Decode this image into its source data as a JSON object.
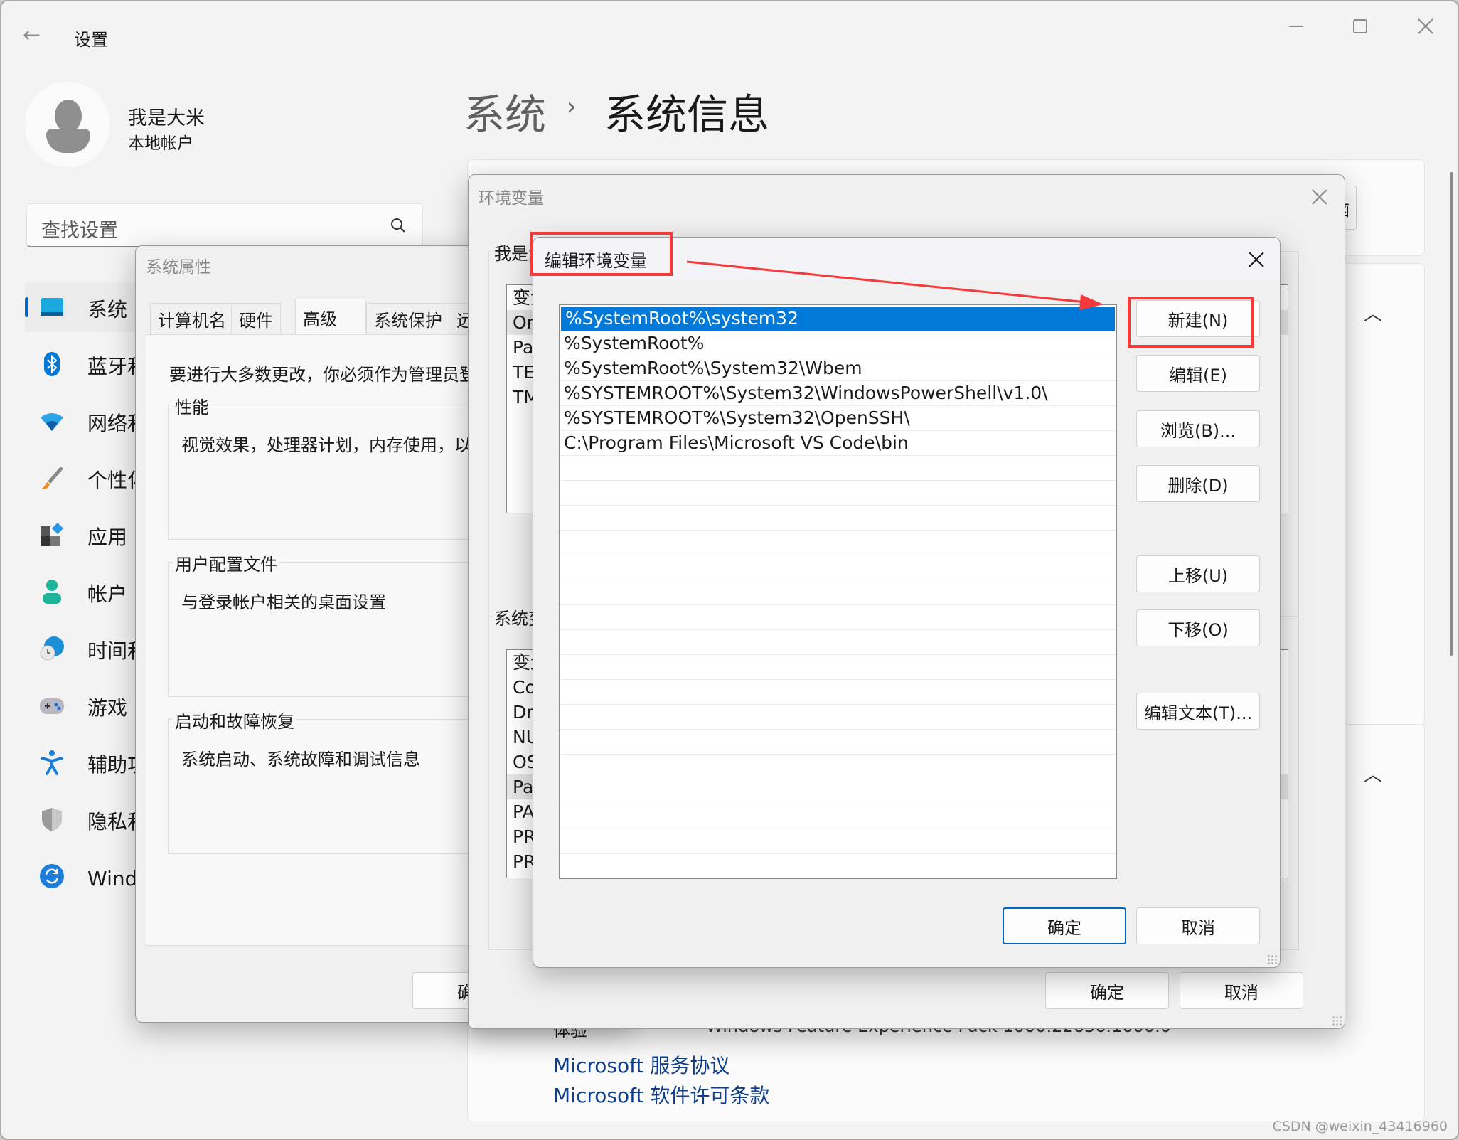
{
  "settings": {
    "app_title": "设置",
    "window_controls": {
      "minimize": "minimize-icon",
      "maximize": "maximize-icon",
      "close": "close-icon"
    },
    "user": {
      "name": "我是大米",
      "account_type": "本地帐户"
    },
    "search": {
      "placeholder": "查找设置"
    },
    "nav": [
      {
        "label": "系统",
        "icon": "system-icon",
        "active": true
      },
      {
        "label": "蓝牙和其他设备",
        "icon": "bluetooth-icon"
      },
      {
        "label": "网络和 Internet",
        "icon": "wifi-icon"
      },
      {
        "label": "个性化",
        "icon": "brush-icon"
      },
      {
        "label": "应用",
        "icon": "apps-icon"
      },
      {
        "label": "帐户",
        "icon": "account-icon"
      },
      {
        "label": "时间和语言",
        "icon": "time-language-icon"
      },
      {
        "label": "游戏",
        "icon": "gamepad-icon"
      },
      {
        "label": "辅助功能",
        "icon": "accessibility-icon"
      },
      {
        "label": "隐私和安全性",
        "icon": "shield-icon"
      },
      {
        "label": "Windows 更新",
        "icon": "update-icon"
      }
    ],
    "breadcrumb": {
      "parent": "系统",
      "separator": "›",
      "current": "系统信息"
    },
    "rename_button": "重命名这台电脑",
    "experience_row": {
      "label": "体验",
      "value": "Windows Feature Experience Pack 1000.22636.1000.0"
    },
    "links": [
      "Microsoft 服务协议",
      "Microsoft 软件许可条款"
    ]
  },
  "system_properties": {
    "title": "系统属性",
    "tabs": [
      "计算机名",
      "硬件",
      "高级",
      "系统保护",
      "远程"
    ],
    "active_tab": "高级",
    "admin_note": "要进行大多数更改，你必须作为管理员登录。",
    "groups": [
      {
        "title": "性能",
        "desc": "视觉效果，处理器计划，内存使用，以及虚拟内存"
      },
      {
        "title": "用户配置文件",
        "desc": "与登录帐户相关的桌面设置"
      },
      {
        "title": "启动和故障恢复",
        "desc": "系统启动、系统故障和调试信息"
      }
    ],
    "ok_button": "确定"
  },
  "env_vars": {
    "title": "环境变量",
    "user_section_title": "我是大米 的用户变量(U)",
    "user_vars_header": "变量",
    "user_vars": [
      "OneDrive",
      "Path",
      "TEMP",
      "TMP"
    ],
    "system_section_title": "系统变量(S)",
    "system_vars_header": "变量",
    "system_vars": [
      "ComSpec",
      "DriverData",
      "NUMBER_OF_PROCESSORS",
      "OS",
      "Path",
      "PATHEXT",
      "PROCESSOR_ARCHITECTURE",
      "PROCESSOR_IDENTIFIER"
    ],
    "ok_button": "确定",
    "cancel_button": "取消"
  },
  "edit_env": {
    "title": "编辑环境变量",
    "paths": [
      "%SystemRoot%\\system32",
      "%SystemRoot%",
      "%SystemRoot%\\System32\\Wbem",
      "%SYSTEMROOT%\\System32\\WindowsPowerShell\\v1.0\\",
      "%SYSTEMROOT%\\System32\\OpenSSH\\",
      "C:\\Program Files\\Microsoft VS Code\\bin"
    ],
    "selected_index": 0,
    "empty_rows": 17,
    "buttons": {
      "new": "新建(N)",
      "edit": "编辑(E)",
      "browse": "浏览(B)...",
      "delete": "删除(D)",
      "move_up": "上移(U)",
      "move_down": "下移(O)",
      "edit_text": "编辑文本(T)..."
    },
    "ok_button": "确定",
    "cancel_button": "取消"
  },
  "annotation": {
    "color": "#f63a3a",
    "highlights": [
      "编辑环境变量",
      "新建(N)"
    ]
  },
  "watermark": "CSDN @weixin_43416960",
  "colors": {
    "accent": "#0067c0",
    "selection": "#0078d7",
    "link": "#0f3f8c",
    "annotation": "#f63a3a"
  }
}
